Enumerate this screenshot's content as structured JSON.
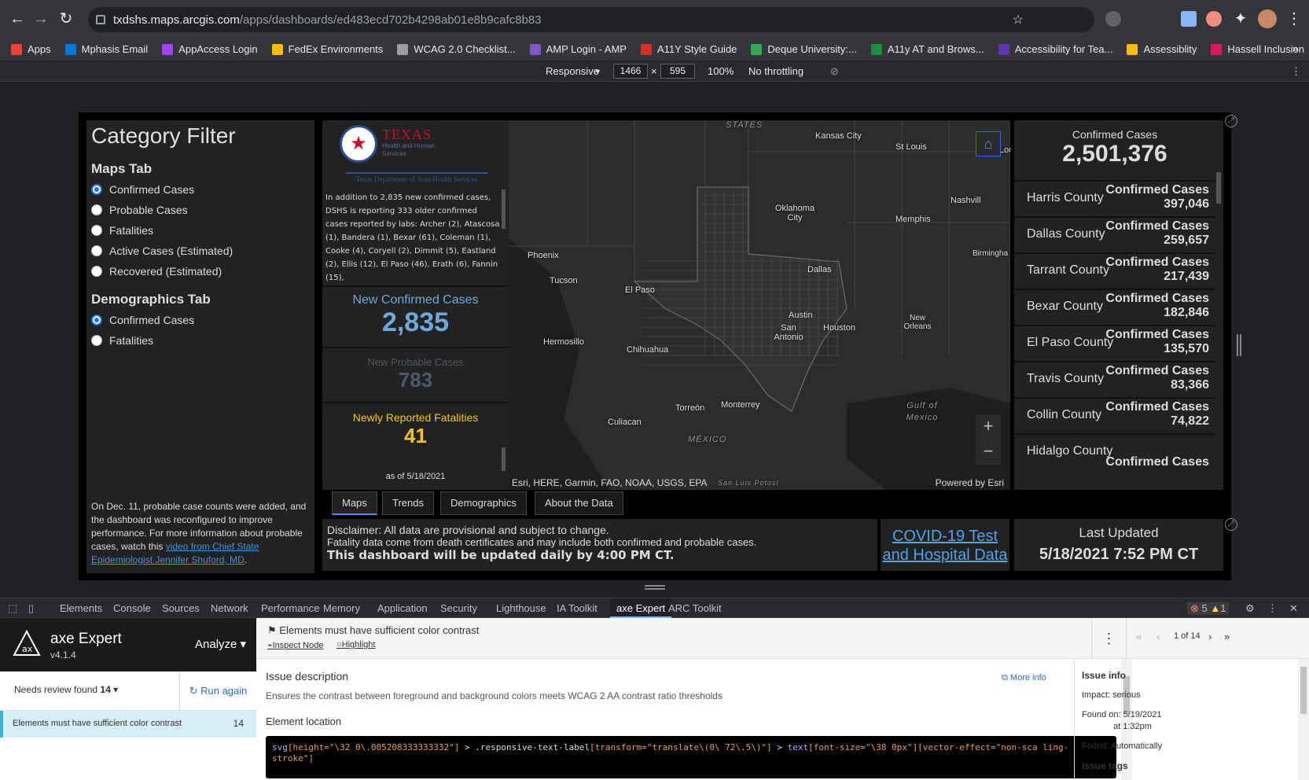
{
  "browser": {
    "url_host": "txdshs.maps.arcgis.com",
    "url_path": "/apps/dashboards/ed483ecd702b4298ab01e8b9cafc8b83",
    "bookmarks": [
      {
        "label": "Apps",
        "color": "#ea4335"
      },
      {
        "label": "Mphasis Email",
        "color": "#0078d4"
      },
      {
        "label": "AppAccess Login",
        "color": "#a142f4"
      },
      {
        "label": "FedEx Environments",
        "color": "#fbbc04"
      },
      {
        "label": "WCAG 2.0 Checklist...",
        "color": "#9aa0a6"
      },
      {
        "label": "AMP Login - AMP",
        "color": "#7e57c2"
      },
      {
        "label": "A11Y Style Guide",
        "color": "#d93025"
      },
      {
        "label": "Deque University:...",
        "color": "#34a853"
      },
      {
        "label": "A11y AT and Brows...",
        "color": "#1e8e3e"
      },
      {
        "label": "Accessibility for Tea...",
        "color": "#5e35b1"
      },
      {
        "label": "Assessiblity",
        "color": "#fbbc04"
      },
      {
        "label": "Hassell Inclusion",
        "color": "#d81b60"
      }
    ],
    "device": {
      "mode": "Responsive",
      "width": "1466",
      "height": "595",
      "zoom": "100%",
      "throttle": "No throttling"
    }
  },
  "category": {
    "title": "Category Filter",
    "maps_heading": "Maps Tab",
    "maps_options": [
      "Confirmed Cases",
      "Probable Cases",
      "Fatalities",
      "Active Cases (Estimated)",
      "Recovered (Estimated)"
    ],
    "demo_heading": "Demographics Tab",
    "demo_options": [
      "Confirmed Cases",
      "Fatalities"
    ],
    "note_pre": "On Dec. 11, probable case counts were added, and the dashboard was reconfigured to improve performance. For more information about probable cases, watch this ",
    "note_link": "video from Chief State Epidemiologist Jennifer Shuford, MD",
    "note_post": "."
  },
  "logo": {
    "name": "TEXAS",
    "sub": "Health and Human Services",
    "dept": "Texas Department of State Health Services"
  },
  "news": "In addition to 2,835 new confirmed cases, DSHS is reporting 333 older confirmed cases reported by labs: Archer (2), Atascosa (1), Bandera (1), Bexar (61), Coleman (1), Cooke (4), Coryell (2), Dimmit (5), Eastland (2), Ellis (12), El Paso (46), Erath (6), Fannin (15),",
  "stats": {
    "new_confirmed_label": "New Confirmed Cases",
    "new_confirmed": "2,835",
    "new_probable_label": "New Probable Cases",
    "new_probable": "783",
    "fatal_label": "Newly Reported Fatalities",
    "fatal": "41",
    "as_of": "as of 5/18/2021"
  },
  "map": {
    "cities": [
      "STATES",
      "Kansas City",
      "St Louis",
      "Lou",
      "Nashvill",
      "Oklahoma City",
      "Memphis",
      "Birmingha",
      "Phoenix",
      "Tucson",
      "Dallas",
      "El Paso",
      "Austin",
      "Houston",
      "New Orleans",
      "San Antonio",
      "Hermosillo",
      "Chihuahua",
      "Torreón",
      "Monterrey",
      "Culiacan",
      "MÉXICO",
      "Gulf of Mexico",
      "San Luis Potosí"
    ],
    "attribution": "Esri, HERE, Garmin, FAO, NOAA, USGS, EPA",
    "powered": "Powered by Esri"
  },
  "totals": {
    "label": "Confirmed Cases",
    "value": "2,501,376",
    "rows": [
      {
        "county": "Harris County",
        "label": "Confirmed Cases",
        "value": "397,046"
      },
      {
        "county": "Dallas County",
        "label": "Confirmed Cases",
        "value": "259,657"
      },
      {
        "county": "Tarrant County",
        "label": "Confirmed Cases",
        "value": "217,439"
      },
      {
        "county": "Bexar County",
        "label": "Confirmed Cases",
        "value": "182,846"
      },
      {
        "county": "El Paso County",
        "label": "Confirmed Cases",
        "value": "135,570"
      },
      {
        "county": "Travis County",
        "label": "Confirmed Cases",
        "value": "83,366"
      },
      {
        "county": "Collin County",
        "label": "Confirmed Cases",
        "value": "74,822"
      },
      {
        "county": "Hidalgo County",
        "label": "Confirmed Cases",
        "value": ""
      }
    ]
  },
  "tabs": [
    "Maps",
    "Trends",
    "Demographics",
    "About the Data"
  ],
  "disclaimer": {
    "d1": "Disclaimer: All data are provisional and subject to change.",
    "d2": "Fatality data come from death certificates and may include both confirmed and probable cases.",
    "d3": "This dashboard will be updated daily by 4:00 PM CT."
  },
  "covid_link": "COVID-19 Test and Hospital Data",
  "last_updated": {
    "label": "Last Updated",
    "value": "5/18/2021 7:52 PM CT"
  },
  "devtools": {
    "tabs": [
      "Elements",
      "Console",
      "Sources",
      "Network",
      "Performance",
      "Memory",
      "Application",
      "Security",
      "Lighthouse",
      "IA Toolkit",
      "axe Expert",
      "ARC Toolkit"
    ],
    "errors": "5",
    "warnings": "1"
  },
  "axe": {
    "brand": "axe Expert",
    "version": "v4.1.4",
    "analyze": "Analyze",
    "needs_review": "Needs review found",
    "needs_count": "14",
    "run_again": "Run again",
    "issue_row": "Elements must have sufficient color contrast",
    "issue_count": "14",
    "issue_title": "Elements must have sufficient color contrast",
    "inspect": "Inspect Node",
    "highlight": "Highlight",
    "pager": "1 of 14",
    "desc_heading": "Issue description",
    "desc": "Ensures the contrast between foreground and background colors meets WCAG 2 AA contrast ratio thresholds",
    "more_info": "More info",
    "loc_heading": "Element location",
    "info_heading": "Issue info",
    "impact": "Impact: serious",
    "found_on": "Found on: 5/19/2021",
    "found_time": "at 1:32pm",
    "found_how": "Found: Automatically",
    "tags": "Issue tags"
  }
}
